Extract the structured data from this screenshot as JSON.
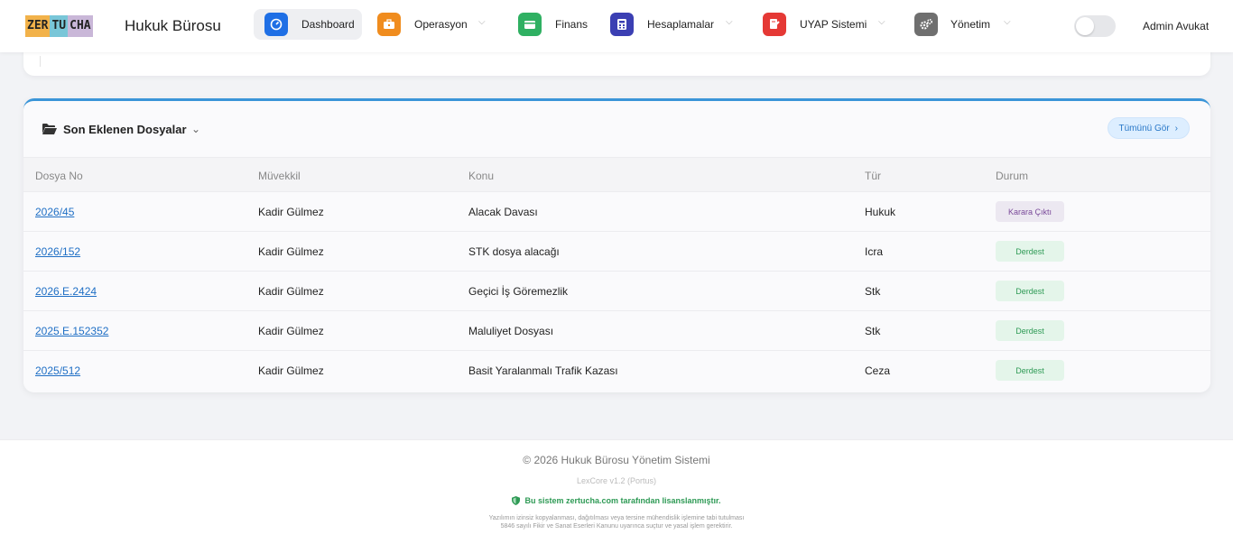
{
  "header": {
    "logo_parts": [
      "ZER",
      "TU",
      "CHA"
    ],
    "brand": "Hukuk Bürosu",
    "nav": [
      {
        "label": "Dashboard",
        "icon": "dashboard-icon",
        "color": "#1f6fe5",
        "active": true
      },
      {
        "label": "Operasyon",
        "icon": "briefcase-icon",
        "color": "#f08c1e",
        "dropdown": true
      },
      {
        "label": "Finans",
        "icon": "wallet-icon",
        "color": "#2fb062"
      },
      {
        "label": "Hesaplamalar",
        "icon": "calculator-icon",
        "color": "#3b3fb3",
        "dropdown": true
      },
      {
        "label": "UYAP Sistemi",
        "icon": "file-signature-icon",
        "color": "#e53935",
        "dropdown": true
      },
      {
        "label": "Yönetim",
        "icon": "gears-icon",
        "color": "#6f6f6f",
        "dropdown": true
      }
    ],
    "user": "Admin Avukat"
  },
  "recent_files": {
    "title": "Son Eklenen Dosyalar",
    "see_all": "Tümünü Gör",
    "columns": [
      "Dosya No",
      "Müvekkil",
      "Konu",
      "Tür",
      "Durum"
    ],
    "rows": [
      {
        "no": "2026/45",
        "client": "Kadir Gülmez",
        "subject": "Alacak Davası",
        "type": "Hukuk",
        "status": "Karara Çıktı",
        "status_bg": "#ece8f1",
        "status_fg": "#7a4a9a"
      },
      {
        "no": "2026/152",
        "client": "Kadir Gülmez",
        "subject": "STK dosya alacağı",
        "type": "Icra",
        "status": "Derdest",
        "status_bg": "#e4f5ea",
        "status_fg": "#2e9a55"
      },
      {
        "no": "2026.E.2424",
        "client": "Kadir Gülmez",
        "subject": "Geçici İş Göremezlik",
        "type": "Stk",
        "status": "Derdest",
        "status_bg": "#e4f5ea",
        "status_fg": "#2e9a55"
      },
      {
        "no": "2025.E.152352",
        "client": "Kadir Gülmez",
        "subject": "Maluliyet Dosyası",
        "type": "Stk",
        "status": "Derdest",
        "status_bg": "#e4f5ea",
        "status_fg": "#2e9a55"
      },
      {
        "no": "2025/512",
        "client": "Kadir Gülmez",
        "subject": "Basit Yaralanmalı Trafik Kazası",
        "type": "Ceza",
        "status": "Derdest",
        "status_bg": "#e4f5ea",
        "status_fg": "#2e9a55"
      }
    ]
  },
  "footer": {
    "copyright": "© 2026 Hukuk Bürosu Yönetim Sistemi",
    "version": "LexCore v1.2 (Portus)",
    "license": "Bu sistem zertucha.com tarafından lisanslanmıştır.",
    "notice": "Yazılımın izinsiz kopyalanması, dağıtılması veya tersine mühendislik işlemine tabi tutulması 5846 sayılı Fikir ve Sanat Eserleri Kanunu uyarınca suçtur ve yasal işlem gerektirir."
  }
}
